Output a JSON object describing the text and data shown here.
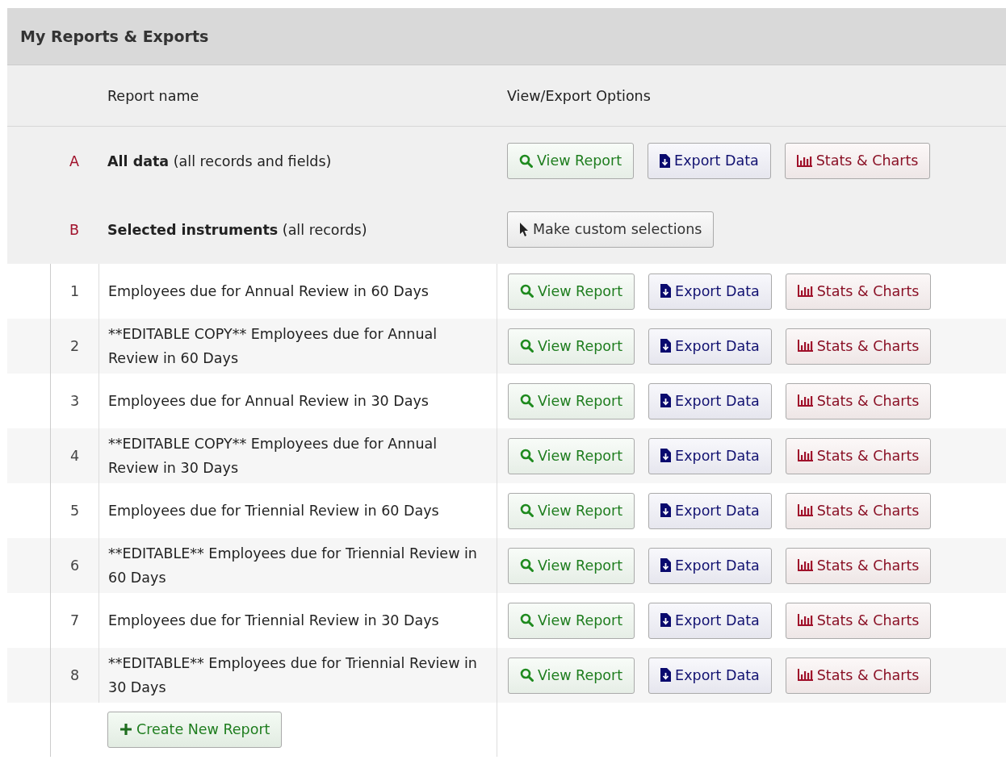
{
  "panel": {
    "title": "My Reports & Exports"
  },
  "columns": [
    "Report name",
    "View/Export Options"
  ],
  "rows": [
    {
      "kind": "special",
      "id": "A",
      "name": "**All data** (all records and fields)",
      "buttons": [
        {
          "kind": "view",
          "label": "View Report"
        },
        {
          "kind": "export",
          "label": "Export Data"
        },
        {
          "kind": "stats",
          "label": "Stats & Charts"
        }
      ]
    },
    {
      "kind": "special",
      "id": "B",
      "name": "**Selected instruments** (all records)",
      "buttons": [
        {
          "kind": "select",
          "label": "Make custom selections"
        }
      ]
    },
    {
      "kind": "report",
      "id": "1",
      "name": "Employees due for Annual Review in 60 Days",
      "buttons": [
        {
          "kind": "view",
          "label": "View Report"
        },
        {
          "kind": "export",
          "label": "Export Data"
        },
        {
          "kind": "stats",
          "label": "Stats & Charts"
        }
      ]
    },
    {
      "kind": "report",
      "id": "2",
      "name": "**EDITABLE COPY** Employees due for Annual Review in 60 Days",
      "buttons": [
        {
          "kind": "view",
          "label": "View Report"
        },
        {
          "kind": "export",
          "label": "Export Data"
        },
        {
          "kind": "stats",
          "label": "Stats & Charts"
        }
      ]
    },
    {
      "kind": "report",
      "id": "3",
      "name": "Employees due for Annual Review in 30 Days",
      "buttons": [
        {
          "kind": "view",
          "label": "View Report"
        },
        {
          "kind": "export",
          "label": "Export Data"
        },
        {
          "kind": "stats",
          "label": "Stats & Charts"
        }
      ]
    },
    {
      "kind": "report",
      "id": "4",
      "name": "**EDITABLE COPY** Employees due for Annual Review in 30 Days",
      "buttons": [
        {
          "kind": "view",
          "label": "View Report"
        },
        {
          "kind": "export",
          "label": "Export Data"
        },
        {
          "kind": "stats",
          "label": "Stats & Charts"
        }
      ]
    },
    {
      "kind": "report",
      "id": "5",
      "name": "Employees due for Triennial Review in 60 Days",
      "buttons": [
        {
          "kind": "view",
          "label": "View Report"
        },
        {
          "kind": "export",
          "label": "Export Data"
        },
        {
          "kind": "stats",
          "label": "Stats & Charts"
        }
      ]
    },
    {
      "kind": "report",
      "id": "6",
      "name": "**EDITABLE** Employees due for Triennial Review in 60 Days",
      "buttons": [
        {
          "kind": "view",
          "label": "View Report"
        },
        {
          "kind": "export",
          "label": "Export Data"
        },
        {
          "kind": "stats",
          "label": "Stats & Charts"
        }
      ]
    },
    {
      "kind": "report",
      "id": "7",
      "name": "Employees due for Triennial Review in 30 Days",
      "buttons": [
        {
          "kind": "view",
          "label": "View Report"
        },
        {
          "kind": "export",
          "label": "Export Data"
        },
        {
          "kind": "stats",
          "label": "Stats & Charts"
        }
      ]
    },
    {
      "kind": "report",
      "id": "8",
      "name": "**EDITABLE** Employees due for Triennial Review in 30 Days",
      "buttons": [
        {
          "kind": "view",
          "label": "View Report"
        },
        {
          "kind": "export",
          "label": "Export Data"
        },
        {
          "kind": "stats",
          "label": "Stats & Charts"
        }
      ]
    }
  ],
  "create_button": {
    "label": "Create New Report"
  }
}
